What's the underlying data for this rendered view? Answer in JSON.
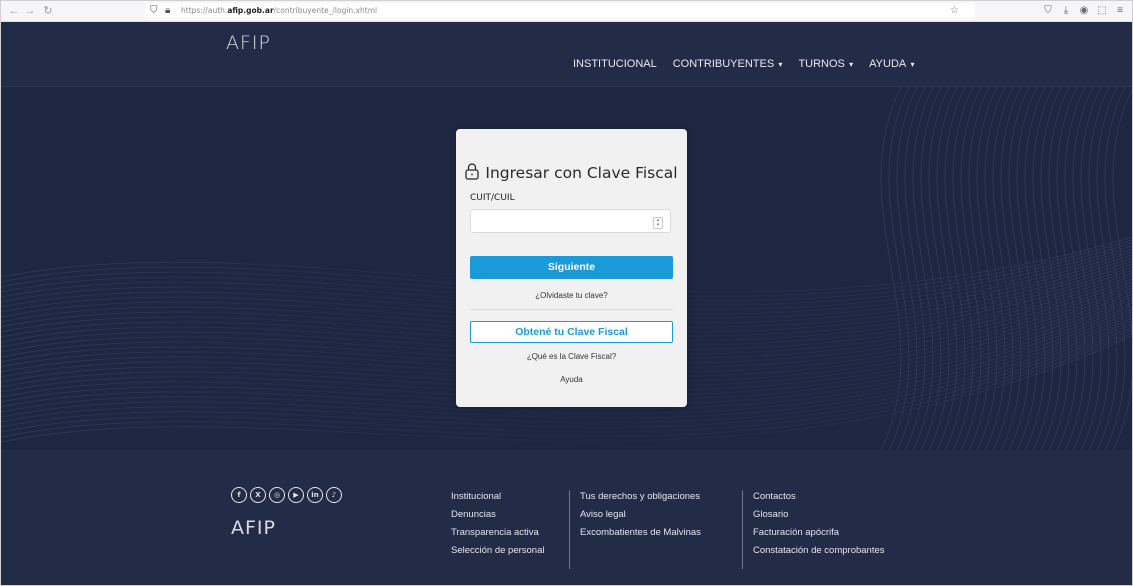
{
  "browser": {
    "url_prefix": "https://auth.",
    "url_domain": "afip.gob.ar",
    "url_path": "/contribuyente_/login.xhtml"
  },
  "header": {
    "logo": "AFIP",
    "nav": [
      {
        "label": "INSTITUCIONAL",
        "dropdown": false
      },
      {
        "label": "CONTRIBUYENTES",
        "dropdown": true
      },
      {
        "label": "TURNOS",
        "dropdown": true
      },
      {
        "label": "AYUDA",
        "dropdown": true
      }
    ]
  },
  "login": {
    "title": "Ingresar con Clave Fiscal",
    "field_label": "CUIT/CUIL",
    "field_value": "",
    "submit_label": "Siguiente",
    "forgot_label": "¿Olvidaste tu clave?",
    "obtain_label": "Obtené tu Clave Fiscal",
    "what_is_label": "¿Qué es la Clave Fiscal?",
    "help_label": "Ayuda"
  },
  "footer": {
    "logo": "AFIP",
    "social": [
      {
        "name": "facebook-icon",
        "glyph": "f"
      },
      {
        "name": "x-twitter-icon",
        "glyph": "X"
      },
      {
        "name": "instagram-icon",
        "glyph": "◎"
      },
      {
        "name": "youtube-icon",
        "glyph": "▶"
      },
      {
        "name": "linkedin-icon",
        "glyph": "in"
      },
      {
        "name": "tiktok-icon",
        "glyph": "♪"
      }
    ],
    "col1": [
      "Institucional",
      "Denuncias",
      "Transparencia activa",
      "Selección de personal"
    ],
    "col2": [
      "Tus derechos y obligaciones",
      "Aviso legal",
      "Excombatientes de Malvinas"
    ],
    "col3": [
      "Contactos",
      "Glosario",
      "Facturación apócrifa",
      "Constatación de comprobantes"
    ]
  },
  "colors": {
    "header_bg": "#232c47",
    "hero_bg": "#1e2742",
    "accent": "#1a9ad9"
  }
}
